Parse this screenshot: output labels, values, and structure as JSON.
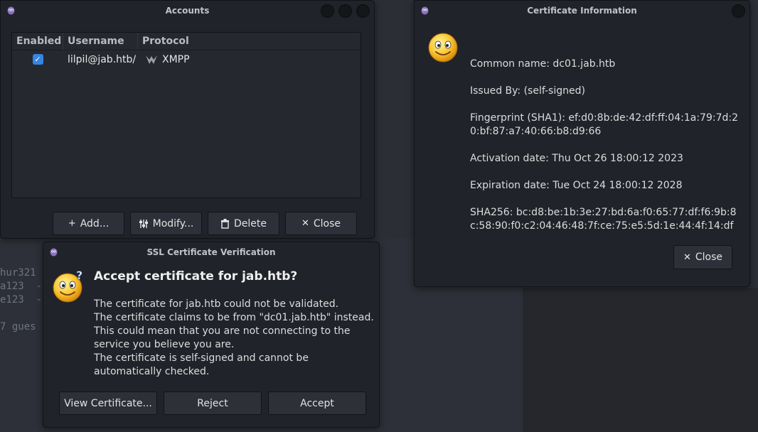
{
  "background": {
    "terminal_lines": [
      "",
      "hur321",
      "a123  -",
      "e123  -",
      "",
      "7 gues"
    ]
  },
  "accounts": {
    "title": "Accounts",
    "columns": [
      "Enabled",
      "Username",
      "Protocol"
    ],
    "rows": [
      {
        "enabled": true,
        "username": "lilpil@jab.htb/",
        "protocol": "XMPP"
      }
    ],
    "buttons": {
      "add": "Add...",
      "modify": "Modify...",
      "delete": "Delete",
      "close": "Close"
    }
  },
  "ssl": {
    "title": "SSL Certificate Verification",
    "headline": "Accept certificate for jab.htb?",
    "body": [
      "The certificate for jab.htb could not be validated.",
      "The certificate claims to be from \"dc01.jab.htb\" instead. This could mean that you are not connecting to the service you believe you are.",
      "The certificate is self-signed and cannot be automatically checked."
    ],
    "buttons": {
      "view": "View Certificate...",
      "reject": "Reject",
      "accept": "Accept"
    }
  },
  "cert": {
    "title": "Certificate Information",
    "fields": [
      "Common name: dc01.jab.htb",
      "Issued By: (self-signed)",
      "Fingerprint (SHA1): ef:d0:8b:de:42:df:ff:04:1a:79:7d:20:bf:87:a7:40:66:b8:d9:66",
      "Activation date: Thu Oct 26 18:00:12 2023",
      "Expiration date: Tue Oct 24 18:00:12 2028",
      "SHA256: bc:d8:be:1b:3e:27:bd:6a:f0:65:77:df:f6:9b:8c:58:90:f0:c2:04:46:48:7f:ce:75:e5:5d:1e:44:4f:14:df"
    ],
    "close": "Close"
  },
  "icons": {
    "app": "pidgin-icon",
    "smiley": "smiley-face-icon",
    "question": "question-mark-icon",
    "protocol": "xmpp-icon",
    "add": "plus-icon",
    "modify": "sliders-icon",
    "delete": "trash-icon",
    "close": "close-icon"
  },
  "colors": {
    "accent": "#3584e4",
    "window_bg": "#202329",
    "button_bg": "#2d3038"
  }
}
